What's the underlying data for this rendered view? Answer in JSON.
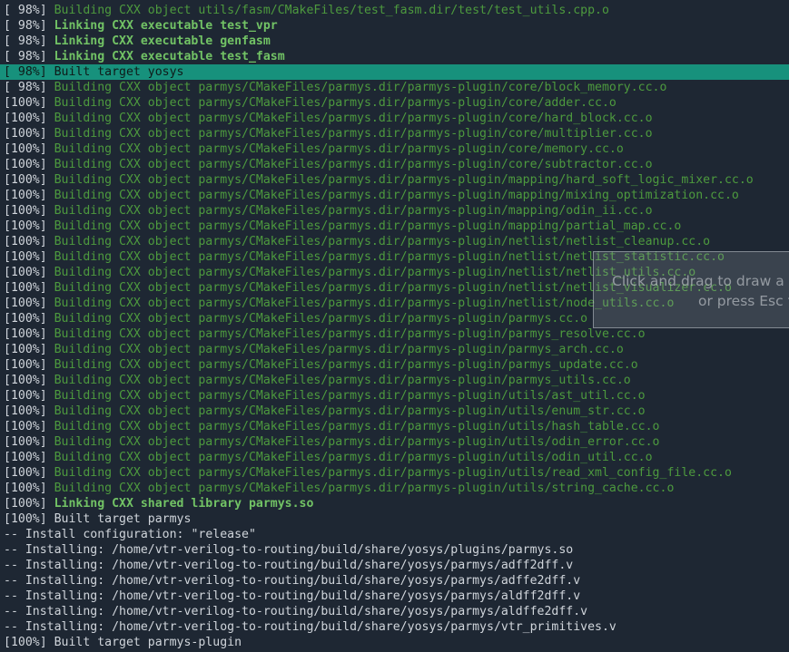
{
  "terminal": {
    "colors": {
      "background": "#1e2733",
      "text": "#d0d5db",
      "build_green": "#4d9a3e",
      "link_green": "#72c365",
      "highlight": "#17917c"
    },
    "lines": [
      {
        "prefix": "[ 98%] ",
        "msg": "Building CXX object utils/fasm/CMakeFiles/test_fasm.dir/test/test_utils.cpp.o",
        "kind": "build"
      },
      {
        "prefix": "[ 98%] ",
        "msg": "Linking CXX executable test_vpr",
        "kind": "link"
      },
      {
        "prefix": "[ 98%] ",
        "msg": "Linking CXX executable genfasm",
        "kind": "link"
      },
      {
        "prefix": "[ 98%] ",
        "msg": "Linking CXX executable test_fasm",
        "kind": "link"
      },
      {
        "prefix": "[ 98%] ",
        "msg": "Built target yosys",
        "kind": "built",
        "highlight": true
      },
      {
        "prefix": "[ 98%] ",
        "msg": "Building CXX object parmys/CMakeFiles/parmys.dir/parmys-plugin/core/block_memory.cc.o",
        "kind": "build"
      },
      {
        "prefix": "[100%] ",
        "msg": "Building CXX object parmys/CMakeFiles/parmys.dir/parmys-plugin/core/adder.cc.o",
        "kind": "build"
      },
      {
        "prefix": "[100%] ",
        "msg": "Building CXX object parmys/CMakeFiles/parmys.dir/parmys-plugin/core/hard_block.cc.o",
        "kind": "build"
      },
      {
        "prefix": "[100%] ",
        "msg": "Building CXX object parmys/CMakeFiles/parmys.dir/parmys-plugin/core/multiplier.cc.o",
        "kind": "build"
      },
      {
        "prefix": "[100%] ",
        "msg": "Building CXX object parmys/CMakeFiles/parmys.dir/parmys-plugin/core/memory.cc.o",
        "kind": "build"
      },
      {
        "prefix": "[100%] ",
        "msg": "Building CXX object parmys/CMakeFiles/parmys.dir/parmys-plugin/core/subtractor.cc.o",
        "kind": "build"
      },
      {
        "prefix": "[100%] ",
        "msg": "Building CXX object parmys/CMakeFiles/parmys.dir/parmys-plugin/mapping/hard_soft_logic_mixer.cc.o",
        "kind": "build"
      },
      {
        "prefix": "[100%] ",
        "msg": "Building CXX object parmys/CMakeFiles/parmys.dir/parmys-plugin/mapping/mixing_optimization.cc.o",
        "kind": "build"
      },
      {
        "prefix": "[100%] ",
        "msg": "Building CXX object parmys/CMakeFiles/parmys.dir/parmys-plugin/mapping/odin_ii.cc.o",
        "kind": "build"
      },
      {
        "prefix": "[100%] ",
        "msg": "Building CXX object parmys/CMakeFiles/parmys.dir/parmys-plugin/mapping/partial_map.cc.o",
        "kind": "build"
      },
      {
        "prefix": "[100%] ",
        "msg": "Building CXX object parmys/CMakeFiles/parmys.dir/parmys-plugin/netlist/netlist_cleanup.cc.o",
        "kind": "build"
      },
      {
        "prefix": "[100%] ",
        "msg": "Building CXX object parmys/CMakeFiles/parmys.dir/parmys-plugin/netlist/netlist_statistic.cc.o",
        "kind": "build"
      },
      {
        "prefix": "[100%] ",
        "msg": "Building CXX object parmys/CMakeFiles/parmys.dir/parmys-plugin/netlist/netlist_utils.cc.o",
        "kind": "build"
      },
      {
        "prefix": "[100%] ",
        "msg": "Building CXX object parmys/CMakeFiles/parmys.dir/parmys-plugin/netlist/netlist_visualizer.cc.o",
        "kind": "build"
      },
      {
        "prefix": "[100%] ",
        "msg": "Building CXX object parmys/CMakeFiles/parmys.dir/parmys-plugin/netlist/node_utils.cc.o",
        "kind": "build"
      },
      {
        "prefix": "[100%] ",
        "msg": "Building CXX object parmys/CMakeFiles/parmys.dir/parmys-plugin/parmys.cc.o",
        "kind": "build"
      },
      {
        "prefix": "[100%] ",
        "msg": "Building CXX object parmys/CMakeFiles/parmys.dir/parmys-plugin/parmys_resolve.cc.o",
        "kind": "build"
      },
      {
        "prefix": "[100%] ",
        "msg": "Building CXX object parmys/CMakeFiles/parmys.dir/parmys-plugin/parmys_arch.cc.o",
        "kind": "build"
      },
      {
        "prefix": "[100%] ",
        "msg": "Building CXX object parmys/CMakeFiles/parmys.dir/parmys-plugin/parmys_update.cc.o",
        "kind": "build"
      },
      {
        "prefix": "[100%] ",
        "msg": "Building CXX object parmys/CMakeFiles/parmys.dir/parmys-plugin/parmys_utils.cc.o",
        "kind": "build"
      },
      {
        "prefix": "[100%] ",
        "msg": "Building CXX object parmys/CMakeFiles/parmys.dir/parmys-plugin/utils/ast_util.cc.o",
        "kind": "build"
      },
      {
        "prefix": "[100%] ",
        "msg": "Building CXX object parmys/CMakeFiles/parmys.dir/parmys-plugin/utils/enum_str.cc.o",
        "kind": "build"
      },
      {
        "prefix": "[100%] ",
        "msg": "Building CXX object parmys/CMakeFiles/parmys.dir/parmys-plugin/utils/hash_table.cc.o",
        "kind": "build"
      },
      {
        "prefix": "[100%] ",
        "msg": "Building CXX object parmys/CMakeFiles/parmys.dir/parmys-plugin/utils/odin_error.cc.o",
        "kind": "build"
      },
      {
        "prefix": "[100%] ",
        "msg": "Building CXX object parmys/CMakeFiles/parmys.dir/parmys-plugin/utils/odin_util.cc.o",
        "kind": "build"
      },
      {
        "prefix": "[100%] ",
        "msg": "Building CXX object parmys/CMakeFiles/parmys.dir/parmys-plugin/utils/read_xml_config_file.cc.o",
        "kind": "build"
      },
      {
        "prefix": "[100%] ",
        "msg": "Building CXX object parmys/CMakeFiles/parmys.dir/parmys-plugin/utils/string_cache.cc.o",
        "kind": "build"
      },
      {
        "prefix": "[100%] ",
        "msg": "Linking CXX shared library parmys.so",
        "kind": "link"
      },
      {
        "prefix": "[100%] ",
        "msg": "Built target parmys",
        "kind": "built"
      },
      {
        "prefix": "-- ",
        "msg": "Install configuration: \"release\"",
        "kind": "install"
      },
      {
        "prefix": "-- ",
        "msg": "Installing: /home/vtr-verilog-to-routing/build/share/yosys/plugins/parmys.so",
        "kind": "install"
      },
      {
        "prefix": "-- ",
        "msg": "Installing: /home/vtr-verilog-to-routing/build/share/yosys/parmys/adff2dff.v",
        "kind": "install"
      },
      {
        "prefix": "-- ",
        "msg": "Installing: /home/vtr-verilog-to-routing/build/share/yosys/parmys/adffe2dff.v",
        "kind": "install"
      },
      {
        "prefix": "-- ",
        "msg": "Installing: /home/vtr-verilog-to-routing/build/share/yosys/parmys/aldff2dff.v",
        "kind": "install"
      },
      {
        "prefix": "-- ",
        "msg": "Installing: /home/vtr-verilog-to-routing/build/share/yosys/parmys/aldffe2dff.v",
        "kind": "install"
      },
      {
        "prefix": "-- ",
        "msg": "Installing: /home/vtr-verilog-to-routing/build/share/yosys/parmys/vtr_primitives.v",
        "kind": "install"
      },
      {
        "prefix": "[100%] ",
        "msg": "Built target parmys-plugin",
        "kind": "built"
      }
    ]
  },
  "screenshot_overlay": {
    "hint_line1": "Click and drag to draw a se",
    "hint_line2": "or press Esc t"
  }
}
